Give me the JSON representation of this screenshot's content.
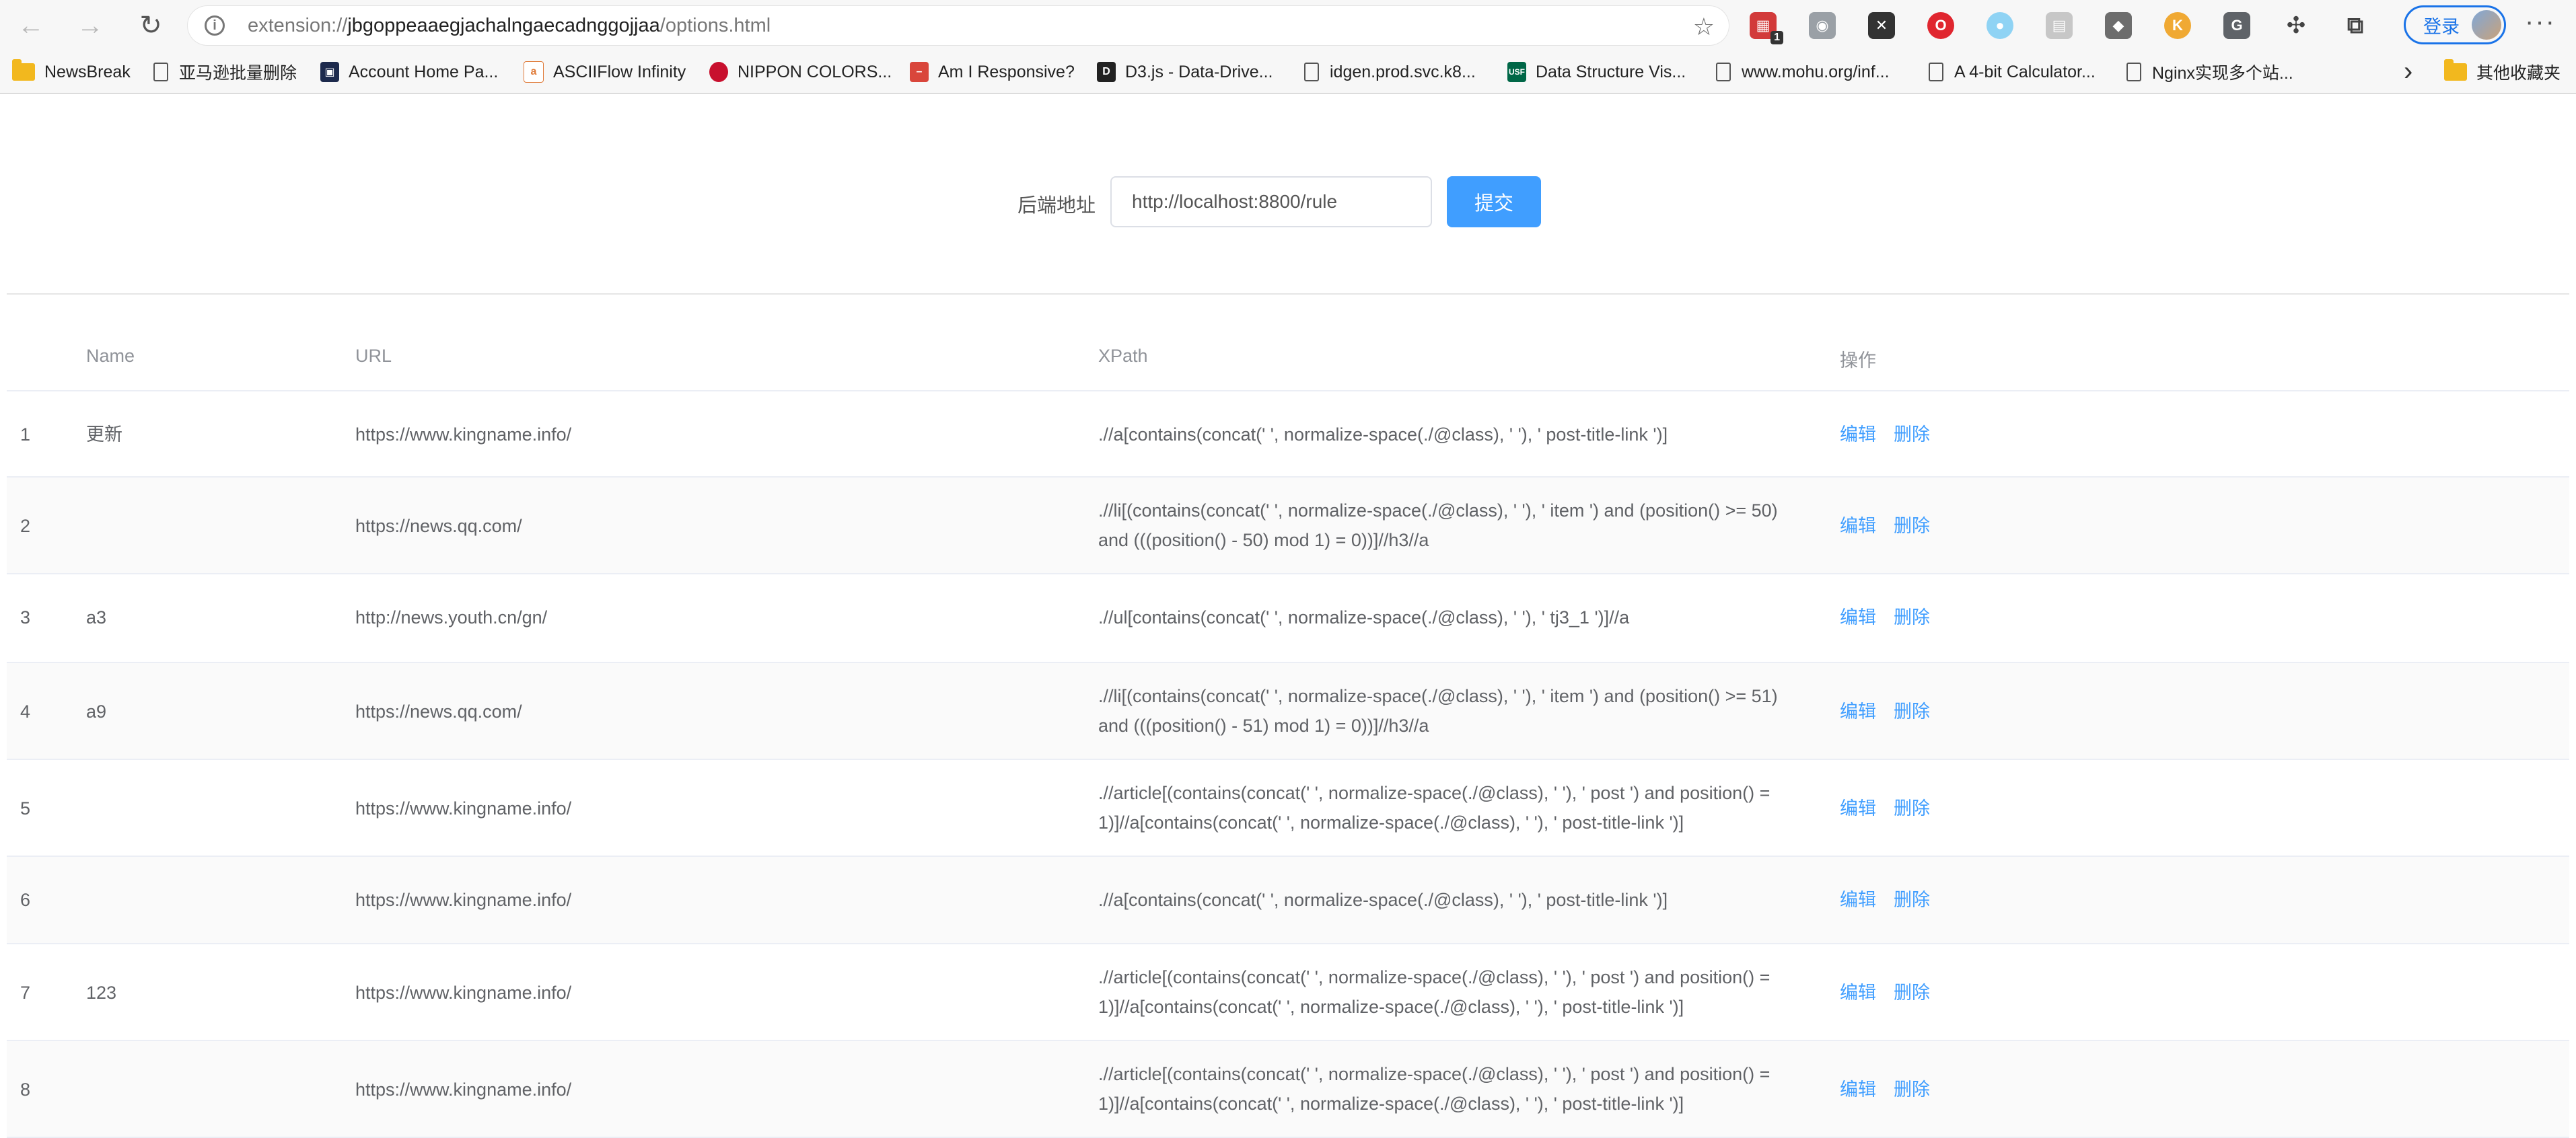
{
  "browser": {
    "url_prefix": "extension://",
    "url_host": "jbgoppeaaegjachalngaecadnggojjaa",
    "url_path": "/options.html",
    "login_label": "登录",
    "extension_badge": "1",
    "bookmarks": [
      {
        "label": "NewsBreak",
        "icon": "folder-icon"
      },
      {
        "label": "亚马逊批量删除",
        "icon": "page-icon"
      },
      {
        "label": "Account Home Pa...",
        "icon": "site-icon"
      },
      {
        "label": "ASCIIFlow Infinity",
        "icon": "site-icon"
      },
      {
        "label": "NIPPON COLORS...",
        "icon": "site-icon"
      },
      {
        "label": "Am I Responsive?",
        "icon": "site-icon"
      },
      {
        "label": "D3.js - Data-Drive...",
        "icon": "site-icon"
      },
      {
        "label": "idgen.prod.svc.k8...",
        "icon": "page-icon"
      },
      {
        "label": "Data Structure Vis...",
        "icon": "site-icon"
      },
      {
        "label": "www.mohu.org/inf...",
        "icon": "page-icon"
      },
      {
        "label": "A 4-bit Calculator...",
        "icon": "page-icon"
      },
      {
        "label": "Nginx实现多个站...",
        "icon": "page-icon"
      },
      {
        "label": "其他收藏夹",
        "icon": "folder-icon"
      }
    ]
  },
  "form": {
    "label": "后端地址",
    "input_value": "http://localhost:8800/rule",
    "submit_label": "提交"
  },
  "table": {
    "headers": {
      "name": "Name",
      "url": "URL",
      "xpath": "XPath",
      "ops": "操作"
    },
    "edit_label": "编辑",
    "delete_label": "删除",
    "rows": [
      {
        "idx": "1",
        "name": "更新",
        "url": "https://www.kingname.info/",
        "xpath": [
          ".//a[contains(concat(' ', normalize-space(./@class), ' '), ' post-title-link ')]"
        ]
      },
      {
        "idx": "2",
        "name": "",
        "url": "https://news.qq.com/",
        "xpath": [
          ".//li[(contains(concat(' ', normalize-space(./@class), ' '), ' item ') and (position() >= 50)",
          "and (((position() - 50) mod 1) = 0))]//h3//a"
        ]
      },
      {
        "idx": "3",
        "name": "a3",
        "url": "http://news.youth.cn/gn/",
        "xpath": [
          ".//ul[contains(concat(' ', normalize-space(./@class), ' '), ' tj3_1 ')]//a"
        ]
      },
      {
        "idx": "4",
        "name": "a9",
        "url": "https://news.qq.com/",
        "xpath": [
          ".//li[(contains(concat(' ', normalize-space(./@class), ' '), ' item ') and (position() >= 51)",
          "and (((position() - 51) mod 1) = 0))]//h3//a"
        ]
      },
      {
        "idx": "5",
        "name": "",
        "url": "https://www.kingname.info/",
        "xpath": [
          ".//article[(contains(concat(' ', normalize-space(./@class), ' '), ' post ') and position() =",
          "1)]//a[contains(concat(' ', normalize-space(./@class), ' '), ' post-title-link ')]"
        ]
      },
      {
        "idx": "6",
        "name": "",
        "url": "https://www.kingname.info/",
        "xpath": [
          ".//a[contains(concat(' ', normalize-space(./@class), ' '), ' post-title-link ')]"
        ]
      },
      {
        "idx": "7",
        "name": "123",
        "url": "https://www.kingname.info/",
        "xpath": [
          ".//article[(contains(concat(' ', normalize-space(./@class), ' '), ' post ') and position() =",
          "1)]//a[contains(concat(' ', normalize-space(./@class), ' '), ' post-title-link ')]"
        ]
      },
      {
        "idx": "8",
        "name": "",
        "url": "https://www.kingname.info/",
        "xpath": [
          ".//article[(contains(concat(' ', normalize-space(./@class), ' '), ' post ') and position() =",
          "1)]//a[contains(concat(' ', normalize-space(./@class), ' '), ' post-title-link ')]"
        ]
      }
    ]
  },
  "colors": {
    "primary": "#409eff",
    "chrome_bg": "#f7f7f7",
    "stripe": "#fafafa"
  }
}
